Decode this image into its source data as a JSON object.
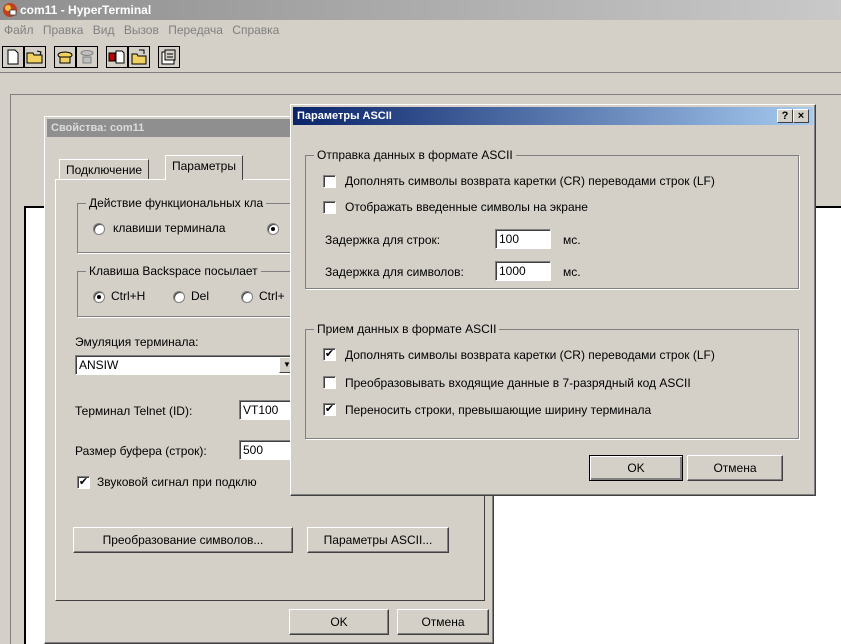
{
  "window": {
    "title": "com11 - HyperTerminal",
    "menu": [
      "Файл",
      "Правка",
      "Вид",
      "Вызов",
      "Передача",
      "Справка"
    ],
    "toolbar_icons": [
      "new-file-icon",
      "open-folder-icon",
      "phone-connect-icon",
      "phone-disconnect-icon",
      "send-file-icon",
      "receive-file-icon",
      "properties-icon"
    ]
  },
  "properties": {
    "title": "Свойства: com11",
    "tabs": [
      "Подключение",
      "Параметры"
    ],
    "function_keys": {
      "label": "Действие функциональных кла",
      "option_terminal": "клавиши терминала"
    },
    "backspace": {
      "label": "Клавиша  Backspace посылает",
      "opt1": "Ctrl+H",
      "opt2": "Del",
      "opt3": "Ctrl+"
    },
    "emulation_label": "Эмуляция терминала:",
    "emulation_value": "ANSIW",
    "telnet_label": "Терминал Telnet (ID):",
    "telnet_value": "VT100",
    "buffer_label": "Размер буфера (строк):",
    "buffer_value": "500",
    "beep_label": "Звуковой сигнал при подклю",
    "beep_checked": "✔",
    "char_conversion_button": "Преобразование символов...",
    "ascii_setup_button": "Параметры ASCII...",
    "ok_button": "OK",
    "cancel_button": "Отмена"
  },
  "ascii": {
    "title": "Параметры ASCII",
    "help_button": "?",
    "close_button": "×",
    "sending": {
      "label": "Отправка данных в формате ASCII",
      "append_lf": "Дополнять символы возврата каретки (CR) переводами строк (LF)",
      "append_lf_checked": "",
      "echo": "Отображать введенные символы на экране",
      "echo_checked": "",
      "line_delay_label": "Задержка для строк:",
      "line_delay_value": "100",
      "line_delay_unit": "мс.",
      "char_delay_label": "Задержка для символов:",
      "char_delay_value": "1000",
      "char_delay_unit": "мс."
    },
    "receiving": {
      "label": "Прием данных в формате ASCII",
      "append_lf": "Дополнять символы возврата каретки (CR) переводами строк (LF)",
      "append_lf_checked": "✔",
      "force_7bit": "Преобразовывать входящие данные в 7-разрядный код ASCII",
      "force_7bit_checked": "",
      "wrap": "Переносить строки, превышающие ширину терминала",
      "wrap_checked": "✔"
    },
    "ok_button": "OK",
    "cancel_button": "Отмена"
  }
}
